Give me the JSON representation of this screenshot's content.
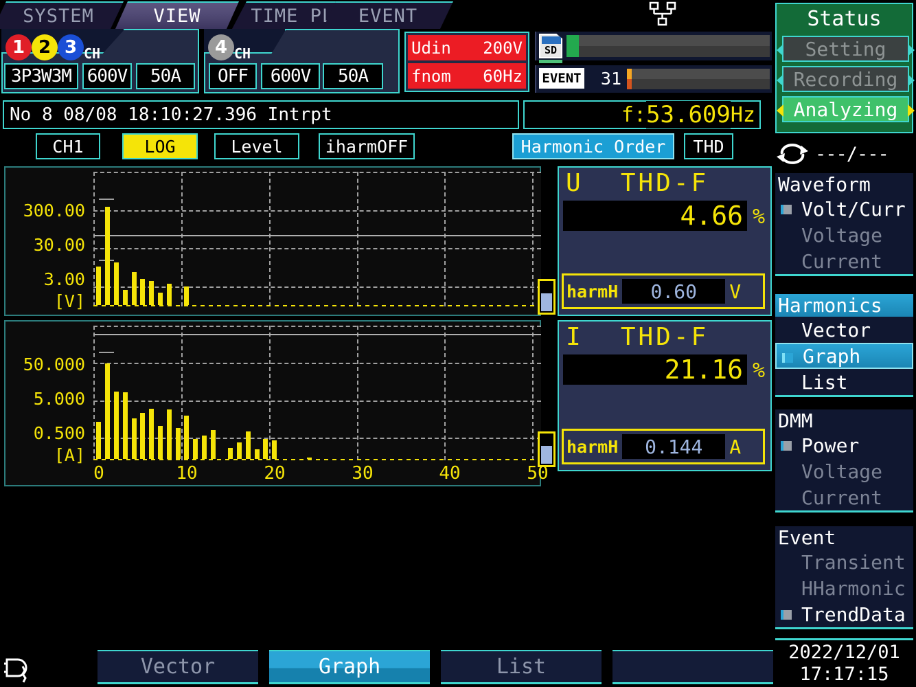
{
  "tabs": [
    {
      "label": "SYSTEM",
      "active": false
    },
    {
      "label": "VIEW",
      "active": true
    },
    {
      "label": "TIME PLOT",
      "active": false
    },
    {
      "label": "EVENT",
      "active": false
    }
  ],
  "channels": {
    "group_a": {
      "ch_label": "CH",
      "numbers": [
        "1",
        "2",
        "3"
      ],
      "wiring": "3P3W3M",
      "voltage_range": "600V",
      "current_range": "50A"
    },
    "group_b": {
      "ch_label": "CH",
      "numbers": [
        "4"
      ],
      "state": "OFF",
      "voltage_range": "600V",
      "current_range": "50A"
    }
  },
  "nominal": {
    "udin_label": "Udin",
    "udin_value": "200V",
    "fnom_label": "fnom",
    "fnom_value": "60Hz"
  },
  "media": {
    "sd_label": "SD",
    "sd_fill_percent": 6
  },
  "event": {
    "badge": "EVENT",
    "count": "31",
    "fill_percent": 3
  },
  "icons": {
    "network": "network-icon",
    "plug": "plug-icon",
    "cycle": "cycle-icon"
  },
  "info": {
    "record_line": "No   8 08/08 18:10:27.396 Intrpt"
  },
  "frequency": {
    "label": "f:",
    "value": "53.609",
    "unit": "Hz"
  },
  "toolbar": {
    "channel_select": "CH1",
    "scale_mode": "LOG",
    "display_mode": "Level",
    "iharm": "iharmOFF",
    "x_axis_mode": "Harmonic Order",
    "thd": "THD"
  },
  "readouts": {
    "voltage": {
      "symbol": "U",
      "title": "THD-F",
      "value": "4.66",
      "unit": "%",
      "cursor_label": "harmH",
      "cursor_value": "0.60",
      "cursor_unit": "V"
    },
    "current": {
      "symbol": "I",
      "title": "THD-F",
      "value": "21.16",
      "unit": "%",
      "cursor_label": "harmH",
      "cursor_value": "0.144",
      "cursor_unit": "A"
    }
  },
  "sidebar": {
    "status": {
      "title": "Status",
      "items": [
        {
          "label": "Setting",
          "active": false
        },
        {
          "label": "Recording",
          "active": false
        },
        {
          "label": "Analyzing",
          "active": true
        }
      ]
    },
    "cycle_text": "---/---",
    "groups": [
      {
        "header": "Waveform",
        "selected": false,
        "items": [
          {
            "label": "Volt/Curr",
            "dim": false,
            "bullet": true,
            "highlight": false
          },
          {
            "label": "Voltage",
            "dim": true,
            "bullet": false,
            "highlight": false
          },
          {
            "label": "Current",
            "dim": true,
            "bullet": false,
            "highlight": false
          }
        ]
      },
      {
        "header": "Harmonics",
        "selected": true,
        "items": [
          {
            "label": "Vector",
            "dim": false,
            "bullet": false,
            "highlight": false
          },
          {
            "label": "Graph",
            "dim": false,
            "bullet": true,
            "highlight": true
          },
          {
            "label": "List",
            "dim": false,
            "bullet": false,
            "highlight": false
          }
        ]
      },
      {
        "header": "DMM",
        "selected": false,
        "items": [
          {
            "label": "Power",
            "dim": false,
            "bullet": true,
            "highlight": false
          },
          {
            "label": "Voltage",
            "dim": true,
            "bullet": false,
            "highlight": false
          },
          {
            "label": "Current",
            "dim": true,
            "bullet": false,
            "highlight": false
          }
        ]
      },
      {
        "header": "Event",
        "selected": false,
        "items": [
          {
            "label": "Transient",
            "dim": true,
            "bullet": false,
            "highlight": false
          },
          {
            "label": "HHarmonic",
            "dim": true,
            "bullet": false,
            "highlight": false
          },
          {
            "label": "TrendData",
            "dim": false,
            "bullet": true,
            "highlight": false
          }
        ]
      }
    ],
    "datetime": {
      "date": "2022/12/01",
      "time": "17:17:15"
    }
  },
  "function_keys": [
    {
      "label": "Vector",
      "active": false
    },
    {
      "label": "Graph",
      "active": true
    },
    {
      "label": "List",
      "active": false
    },
    {
      "label": "",
      "active": false
    }
  ],
  "chart_data": [
    {
      "type": "bar",
      "id": "voltage-harmonics",
      "title": "U THD-F",
      "ylabel": "[V]",
      "xlabel": "Harmonic Order",
      "yscale": "log",
      "ytick_labels": [
        "300.00",
        "30.00",
        "3.00"
      ],
      "ytick_values": [
        300.0,
        30.0,
        3.0
      ],
      "ylim": [
        0.3,
        1000
      ],
      "xlim": [
        0,
        51
      ],
      "grid": true,
      "categories": [
        0,
        1,
        2,
        3,
        4,
        5,
        6,
        7,
        8,
        9,
        10,
        11,
        12,
        13,
        14,
        15,
        16,
        17,
        18,
        19,
        20,
        21,
        22,
        23,
        24,
        25,
        26,
        27,
        28,
        29,
        30,
        31,
        32,
        33,
        34,
        35,
        36,
        37,
        38,
        39,
        40,
        41,
        42,
        43,
        44,
        45,
        46,
        47,
        48,
        49,
        50
      ],
      "values": [
        3.0,
        110.0,
        3.9,
        0.75,
        2.2,
        1.45,
        1.3,
        0.62,
        1.1,
        0.0,
        0.9,
        0.0,
        0.0,
        0.0,
        0.0,
        0.0,
        0.0,
        0.0,
        0.0,
        0.0,
        0.0,
        0.0,
        0.0,
        0.0,
        0.0,
        0.0,
        0.0,
        0.0,
        0.0,
        0.0,
        0.0,
        0.0,
        0.0,
        0.0,
        0.0,
        0.0,
        0.0,
        0.0,
        0.0,
        0.0,
        0.0,
        0.0,
        0.0,
        0.0,
        0.0,
        0.0,
        0.0,
        0.0,
        0.0,
        0.0,
        0.0
      ],
      "cursor_order": 50,
      "cursor_value": "0.60"
    },
    {
      "type": "bar",
      "id": "current-harmonics",
      "title": "I THD-F",
      "ylabel": "[A]",
      "xlabel": "Harmonic Order",
      "yscale": "log",
      "ytick_labels": [
        "50.000",
        "5.000",
        "0.500"
      ],
      "ytick_values": [
        50.0,
        5.0,
        0.5
      ],
      "ylim": [
        0.05,
        200
      ],
      "xlim": [
        0,
        51
      ],
      "xtick_labels": [
        "0",
        "10",
        "20",
        "30",
        "40",
        "50"
      ],
      "xtick_values": [
        0,
        10,
        20,
        30,
        40,
        50
      ],
      "grid": true,
      "categories": [
        0,
        1,
        2,
        3,
        4,
        5,
        6,
        7,
        8,
        9,
        10,
        11,
        12,
        13,
        14,
        15,
        16,
        17,
        18,
        19,
        20,
        21,
        22,
        23,
        24,
        25,
        26,
        27,
        28,
        29,
        30,
        31,
        32,
        33,
        34,
        35,
        36,
        37,
        38,
        39,
        40,
        41,
        42,
        43,
        44,
        45,
        46,
        47,
        48,
        49,
        50
      ],
      "values": [
        0.5,
        18.0,
        3.2,
        3.0,
        0.62,
        0.85,
        1.1,
        0.38,
        1.05,
        0.33,
        0.72,
        0.17,
        0.21,
        0.3,
        0.0,
        0.1,
        0.14,
        0.27,
        0.09,
        0.17,
        0.16,
        0.0,
        0.0,
        0.0,
        0.052,
        0.0,
        0.0,
        0.0,
        0.0,
        0.0,
        0.0,
        0.0,
        0.0,
        0.0,
        0.0,
        0.0,
        0.0,
        0.0,
        0.0,
        0.0,
        0.0,
        0.0,
        0.0,
        0.0,
        0.0,
        0.0,
        0.0,
        0.0,
        0.0,
        0.0,
        0.0
      ],
      "cursor_order": 50,
      "cursor_value": "0.144"
    }
  ]
}
